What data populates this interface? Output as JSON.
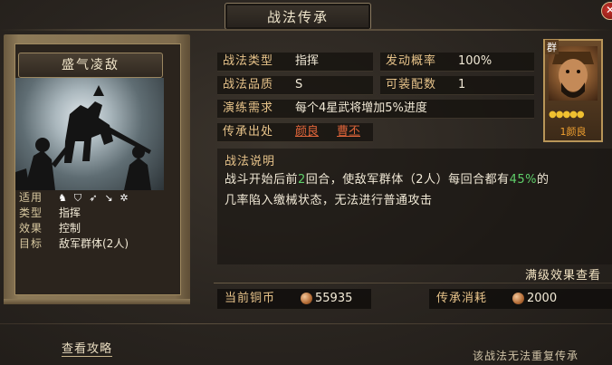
{
  "window": {
    "title": "战法传承"
  },
  "card": {
    "name": "盛气凌敌",
    "info": [
      {
        "key": "适用",
        "value": ""
      },
      {
        "key": "类型",
        "value": "指挥"
      },
      {
        "key": "效果",
        "value": "控制"
      },
      {
        "key": "目标",
        "value": "敌军群体(2人)"
      }
    ],
    "applicable_icons": [
      "cavalry-icon",
      "shield-icon",
      "bow-icon",
      "spear-icon",
      "wheel-icon"
    ]
  },
  "fields": {
    "type": {
      "key": "战法类型",
      "value": "指挥"
    },
    "quality": {
      "key": "战法品质",
      "value": "S"
    },
    "rate": {
      "key": "发动概率",
      "value": "100%"
    },
    "slots": {
      "key": "可装配数",
      "value": "1"
    },
    "training": {
      "key": "演练需求",
      "value": "每个4星武将增加5%进度"
    },
    "origin": {
      "key": "传承出处",
      "links": [
        "颜良",
        "曹丕"
      ]
    }
  },
  "hero": {
    "tag": "群",
    "level": "1",
    "name": "颜良",
    "stars": 5
  },
  "description": {
    "title": "战法说明",
    "seg1": "战斗开始后前",
    "num1": "2",
    "seg2": "回合，使敌军群体（2人）每回合都有",
    "num2": "45%",
    "seg3": "的",
    "line2": "几率陷入缴械状态，无法进行普通攻击"
  },
  "max_effect_link": "满级效果查看",
  "costs": {
    "copper": {
      "key": "当前铜币",
      "value": "55935"
    },
    "inherit": {
      "key": "传承消耗",
      "value": "2000"
    }
  },
  "guide_link": "查看攻略",
  "notice": "该战法无法重复传承",
  "colors": {
    "highlight": "#5fd06a",
    "label": "#e7c38a",
    "link": "#e0653a"
  }
}
